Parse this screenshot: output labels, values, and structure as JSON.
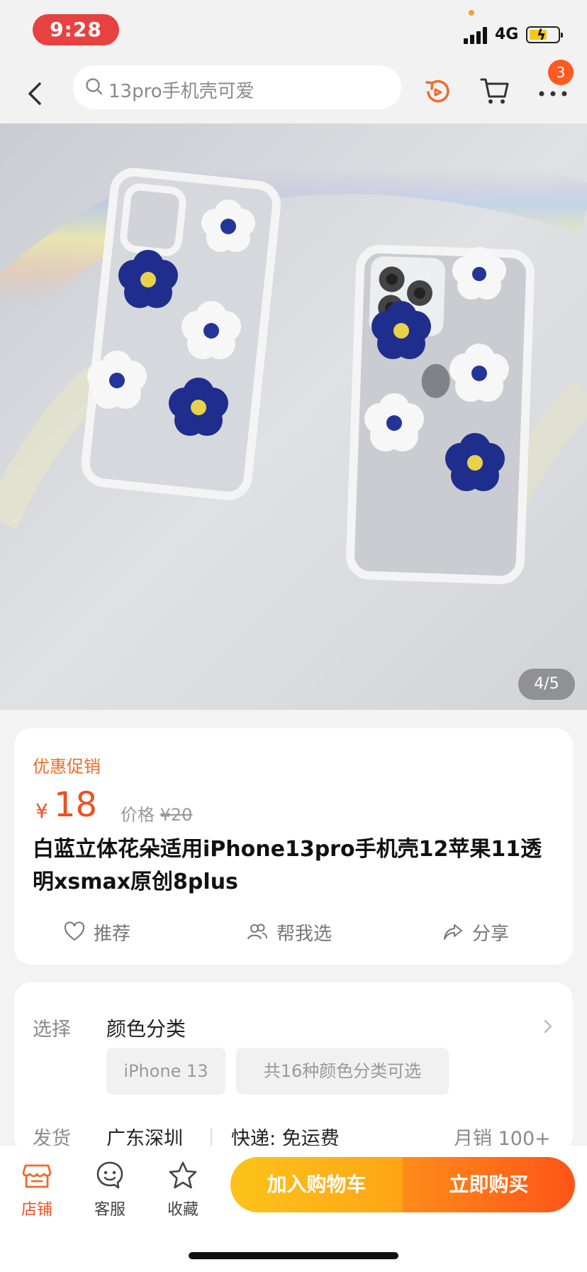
{
  "status_bar": {
    "time": "9:28",
    "network": "4G"
  },
  "header": {
    "search_text": "13pro手机壳可爱",
    "more_badge": "3"
  },
  "gallery": {
    "page_counter": "4/5"
  },
  "product": {
    "promo_label": "优惠促销",
    "currency": "¥",
    "price": "18",
    "orig_price_label": "价格 ",
    "orig_price": "¥20",
    "title": "白蓝立体花朵适用iPhone13pro手机壳12苹果11透明xsmax原创8plus",
    "actions": {
      "recommend": "推荐",
      "help_choose": "帮我选",
      "share": "分享"
    }
  },
  "options": {
    "select_label": "选择",
    "select_title": "颜色分类",
    "chips": [
      "iPhone 13",
      "共16种颜色分类可选"
    ],
    "ship_label": "发货",
    "ship_city": "广东深圳",
    "ship_express": "快递: 免运费",
    "monthly_sales": "月销  100+"
  },
  "bottom_bar": {
    "shop": "店铺",
    "service": "客服",
    "favorite": "收藏",
    "add_to_cart": "加入购物车",
    "buy_now": "立即购买"
  },
  "colors": {
    "accent": "#ee5022",
    "cart_button": "#fdc31a",
    "buy_button": "#ff5418",
    "time_pill": "#e84141"
  }
}
